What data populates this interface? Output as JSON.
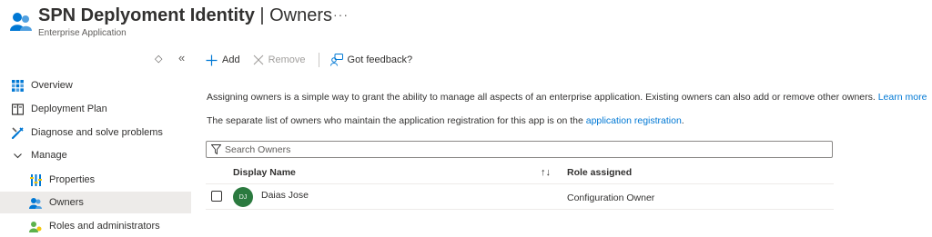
{
  "header": {
    "title": "SPN Deplyoment Identity",
    "separator": " | ",
    "section": "Owners",
    "more": "···",
    "subtitle": "Enterprise Application"
  },
  "sidebar": {
    "collapse_up": "◇",
    "collapse_left": "«",
    "items": [
      {
        "label": "Overview",
        "icon": "overview-grid-icon"
      },
      {
        "label": "Deployment Plan",
        "icon": "book-icon"
      },
      {
        "label": "Diagnose and solve problems",
        "icon": "wrench-icon"
      },
      {
        "label": "Manage",
        "icon": "chevron-down-icon"
      },
      {
        "label": "Properties",
        "icon": "properties-icon"
      },
      {
        "label": "Owners",
        "icon": "users-icon",
        "selected": true
      },
      {
        "label": "Roles and administrators",
        "icon": "roles-icon"
      }
    ]
  },
  "toolbar": {
    "add_label": "Add",
    "remove_label": "Remove",
    "feedback_label": "Got feedback?"
  },
  "main": {
    "intro_text": "Assigning owners is a simple way to grant the ability to manage all aspects of an enterprise application. Existing owners can also add or remove other owners. ",
    "learn_more": "Learn more",
    "registration_text": "The separate list of owners who maintain the application registration for this app is on the ",
    "registration_link": "application registration",
    "registration_end": "."
  },
  "search": {
    "placeholder": "Search Owners",
    "value": ""
  },
  "table": {
    "columns": [
      "Display Name",
      "Role assigned"
    ],
    "sort_icon": "↑↓",
    "rows": [
      {
        "initials": "DJ",
        "display_name": "Daias Jose",
        "role": "Configuration Owner"
      }
    ]
  },
  "colors": {
    "accent": "#0078d4",
    "avatar": "#2b7a3f",
    "selected_bg": "#edebe9"
  }
}
